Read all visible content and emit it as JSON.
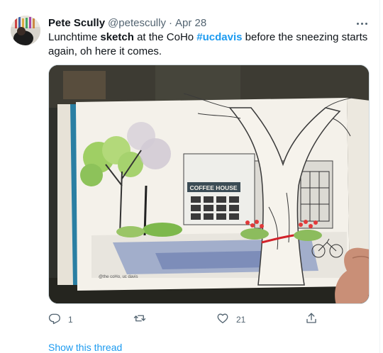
{
  "author": {
    "name": "Pete Scully",
    "handle": "@petescully",
    "separator": "·",
    "date": "Apr 28"
  },
  "tweet": {
    "text_before_sketch": "Lunchtime ",
    "bold_word": "sketch",
    "text_middle": " at the CoHo ",
    "hashtag": "#ucdavis",
    "text_after": " before the sneezing starts again, oh here it comes."
  },
  "media": {
    "sign_text": "COFFEE HOUSE",
    "signature": "@the coHo, uc davis"
  },
  "actions": {
    "reply_count": "1",
    "retweet_count": "",
    "like_count": "21",
    "share_count": ""
  },
  "show_thread_label": "Show this thread",
  "colors": {
    "accent": "#1d9bf0",
    "secondary_text": "#536471",
    "primary_text": "#0f1419"
  },
  "icons": [
    "more-icon",
    "reply-icon",
    "retweet-icon",
    "like-icon",
    "share-icon"
  ]
}
